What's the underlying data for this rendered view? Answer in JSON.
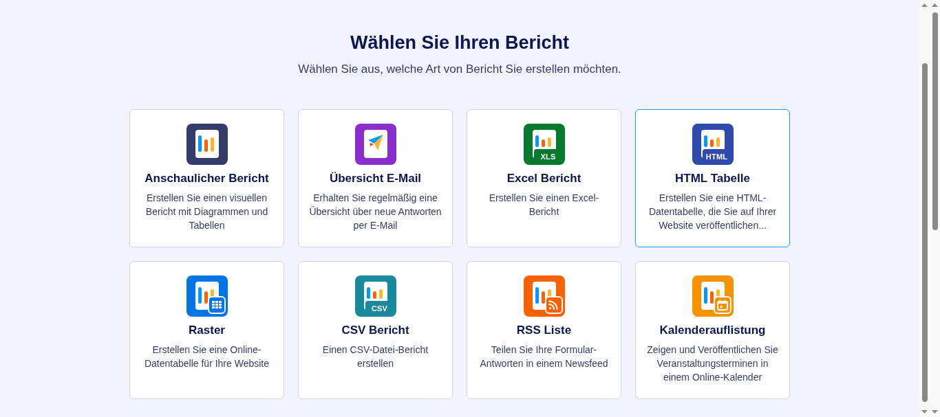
{
  "header": {
    "title": "Wählen Sie Ihren Bericht",
    "subtitle": "Wählen Sie aus, welche Art von Bericht Sie erstellen möchten."
  },
  "cards": [
    {
      "kind": "visual",
      "title": "Anschaulicher Bericht",
      "description": "Erstellen Sie einen visuellen Bericht mit Diagrammen und Tabellen",
      "selected": false
    },
    {
      "kind": "email",
      "title": "Übersicht E-Mail",
      "description": "Erhalten Sie regelmäßig eine Übersicht über neue Antworten per E-Mail",
      "selected": false
    },
    {
      "kind": "excel",
      "badge": "XLS",
      "title": "Excel Bericht",
      "description": "Erstellen Sie einen Excel-Bericht",
      "selected": false
    },
    {
      "kind": "html",
      "badge": "HTML",
      "title": "HTML Tabelle",
      "description": "Erstellen Sie eine HTML-Datentabelle, die Sie auf Ihrer Website veröffentlichen...",
      "selected": true
    },
    {
      "kind": "grid",
      "title": "Raster",
      "description": "Erstellen Sie eine Online-Datentabelle für Ihre Website",
      "selected": false
    },
    {
      "kind": "csv",
      "badge": "CSV",
      "title": "CSV Bericht",
      "description": "Einen CSV-Datei-Bericht erstellen",
      "selected": false
    },
    {
      "kind": "rss",
      "title": "RSS Liste",
      "description": "Teilen Sie Ihre Formular-Antworten in einem Newsfeed",
      "selected": false
    },
    {
      "kind": "calendar",
      "title": "Kalenderauflistung",
      "description": "Zeigen und Veröffentlichen Sie Veranstaltungsterminen in einem Online-Kalender",
      "selected": false
    }
  ]
}
